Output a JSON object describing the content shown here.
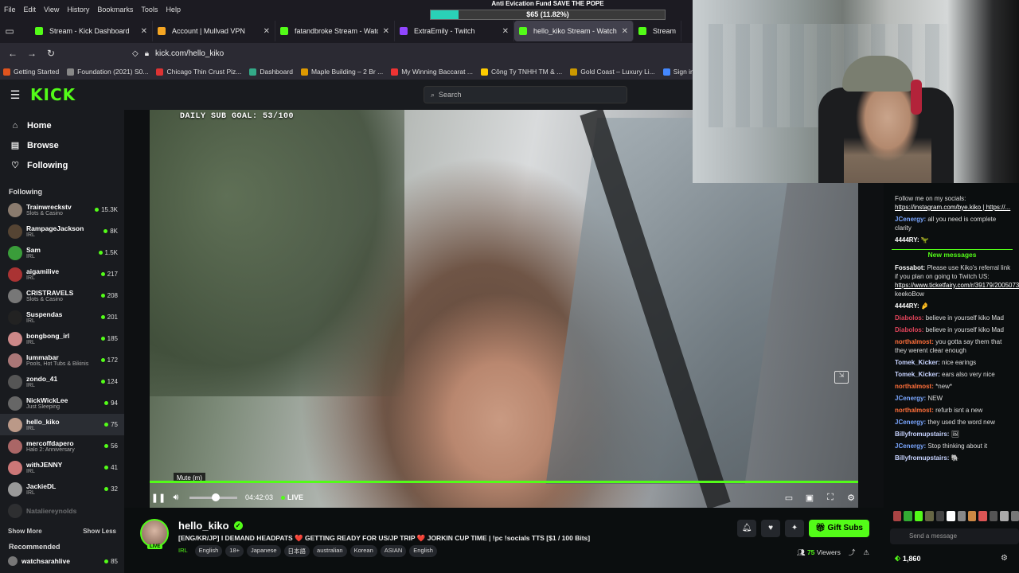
{
  "menu": [
    "File",
    "Edit",
    "View",
    "History",
    "Bookmarks",
    "Tools",
    "Help"
  ],
  "tabs": [
    {
      "label": "Stream - Kick Dashboard",
      "color": "#53fc18"
    },
    {
      "label": "Account | Mullvad VPN",
      "color": "#f5a623"
    },
    {
      "label": "fatandbroke Stream - Watch Li",
      "color": "#53fc18"
    },
    {
      "label": "ExtraEmily - Twitch",
      "color": "#9146ff"
    },
    {
      "label": "hello_kiko Stream - Watch",
      "color": "#53fc18"
    },
    {
      "label": "Stream - Kic",
      "color": "#53fc18"
    }
  ],
  "url": "kick.com/hello_kiko",
  "bookmarks": [
    {
      "label": "Getting Started",
      "color": "#e0541e"
    },
    {
      "label": "Foundation (2021) S0...",
      "color": "#888"
    },
    {
      "label": "Chicago Thin Crust Piz...",
      "color": "#d33"
    },
    {
      "label": "Dashboard",
      "color": "#3a8"
    },
    {
      "label": "Maple Building – 2 Br ...",
      "color": "#d90"
    },
    {
      "label": "My Winning Baccarat ...",
      "color": "#e33"
    },
    {
      "label": "Công Ty TNHH TM & ...",
      "color": "#fc0"
    },
    {
      "label": "Gold Coast – Luxury Li...",
      "color": "#c90"
    },
    {
      "label": "Sign in - Dream",
      "color": "#48f"
    }
  ],
  "goal": {
    "title": "Anti Evication Fund SAVE THE POPE",
    "amount": "$65 (11.82%)",
    "fill": 0.1182
  },
  "search_placeholder": "Search",
  "nav": [
    {
      "icon": "⌂",
      "label": "Home"
    },
    {
      "icon": "▤",
      "label": "Browse"
    },
    {
      "icon": "♡",
      "label": "Following"
    }
  ],
  "following_heading": "Following",
  "following": [
    {
      "name": "Trainwreckstv",
      "cat": "Slots & Casino",
      "count": "15.3K",
      "color": "#8a7b6e"
    },
    {
      "name": "RampageJackson",
      "cat": "IRL",
      "count": "8K",
      "color": "#554433"
    },
    {
      "name": "Sam",
      "cat": "IRL",
      "count": "1.5K",
      "color": "#3a9d3a"
    },
    {
      "name": "aigamilive",
      "cat": "IRL",
      "count": "217",
      "color": "#a33"
    },
    {
      "name": "CRISTRAVELS",
      "cat": "Slots & Casino",
      "count": "208",
      "color": "#777"
    },
    {
      "name": "Suspendas",
      "cat": "IRL",
      "count": "201",
      "color": "#222"
    },
    {
      "name": "bongbong_irl",
      "cat": "IRL",
      "count": "185",
      "color": "#c88"
    },
    {
      "name": "lummabar",
      "cat": "Pools, Hot Tubs & Bikinis",
      "count": "172",
      "color": "#a77"
    },
    {
      "name": "zondo_41",
      "cat": "IRL",
      "count": "124",
      "color": "#555"
    },
    {
      "name": "NickWickLee",
      "cat": "Just Sleeping",
      "count": "94",
      "color": "#666"
    },
    {
      "name": "hello_kiko",
      "cat": "IRL",
      "count": "75",
      "color": "#b98"
    },
    {
      "name": "mercoffdapero",
      "cat": "Halo 2: Anniversary",
      "count": "56",
      "color": "#a66"
    },
    {
      "name": "withJENNY",
      "cat": "IRL",
      "count": "41",
      "color": "#c77"
    },
    {
      "name": "JackieDL",
      "cat": "IRL",
      "count": "32",
      "color": "#999"
    },
    {
      "name": "Nataliereynolds",
      "cat": "",
      "count": "",
      "color": "#555"
    }
  ],
  "show_more": "Show More",
  "show_less": "Show Less",
  "recommended_heading": "Recommended",
  "recommended": [
    {
      "name": "watchsarahlive",
      "count": "85"
    }
  ],
  "video": {
    "sub_goal": "DAILY SUB GOAL: 53/100",
    "tooltip": "Mute (m)",
    "time": "04:42:03",
    "live": "LIVE"
  },
  "stream": {
    "name": "hello_kiko",
    "live_badge": "LIVE",
    "title": "[ENG/KR/JP] I DEMAND HEADPATS ❤️ GETTING READY FOR US/JP TRIP ❤️ JORKIN CUP TIME | !pc !socials TTS [$1 / 100 Bits]",
    "category": "IRL",
    "tags": [
      "English",
      "18+",
      "Japanese",
      "日本語",
      "australian",
      "Korean",
      "ASIAN",
      "English"
    ],
    "gift": "Gift Subs",
    "viewers": "75",
    "viewers_label": "Viewers"
  },
  "chat": {
    "top": [
      {
        "user": "",
        "text": "Follow me on my socials: ",
        "link": "https://instagram.com/bye.kiko | https://...",
        "ucolor": "#fff"
      },
      {
        "user": "JCenergy:",
        "text": "all you need is complete clarity",
        "ucolor": "#7aa6ff"
      },
      {
        "user": "4444RY:",
        "text": "🦖",
        "ucolor": "#fff"
      }
    ],
    "new_messages": "New messages",
    "messages": [
      {
        "user": "Fossabot:",
        "text": "Please use Kiko's referral link if you plan on going to Twitch US: ",
        "link": "https://www.ticketfairy.com/r/39179/2005073",
        "tail": " keekoBow",
        "ucolor": "#fff"
      },
      {
        "user": "4444RY:",
        "text": "🤌",
        "ucolor": "#fff"
      },
      {
        "user": "Diabolos:",
        "text": "believe in yourself kiko Mad",
        "ucolor": "#e0445a"
      },
      {
        "user": "Diabolos:",
        "text": "believe in yourself kiko Mad",
        "ucolor": "#e0445a"
      },
      {
        "user": "northalmost:",
        "text": "you gotta say them that they werent clear enough",
        "ucolor": "#ff6f3a"
      },
      {
        "user": "Tomek_Kicker:",
        "text": "nice earings",
        "ucolor": "#c7d3ff"
      },
      {
        "user": "Tomek_Kicker:",
        "text": "ears also very nice",
        "ucolor": "#c7d3ff"
      },
      {
        "user": "northalmost:",
        "text": "*new*",
        "ucolor": "#ff6f3a"
      },
      {
        "user": "JCenergy:",
        "text": "NEW",
        "ucolor": "#7aa6ff"
      },
      {
        "user": "northalmost:",
        "text": "refurb isnt a new",
        "ucolor": "#ff6f3a"
      },
      {
        "user": "JCenergy:",
        "text": "they used the word new",
        "ucolor": "#7aa6ff"
      },
      {
        "user": "Billyfromupstairs:",
        "text": "🖼",
        "ucolor": "#c7d3ff"
      },
      {
        "user": "JCenergy:",
        "text": "Stop thinking about it",
        "ucolor": "#7aa6ff"
      },
      {
        "user": "Billyfromupstairs:",
        "text": "🐘",
        "ucolor": "#c7d3ff"
      }
    ],
    "input_placeholder": "Send a message",
    "kicks": "1,860"
  }
}
